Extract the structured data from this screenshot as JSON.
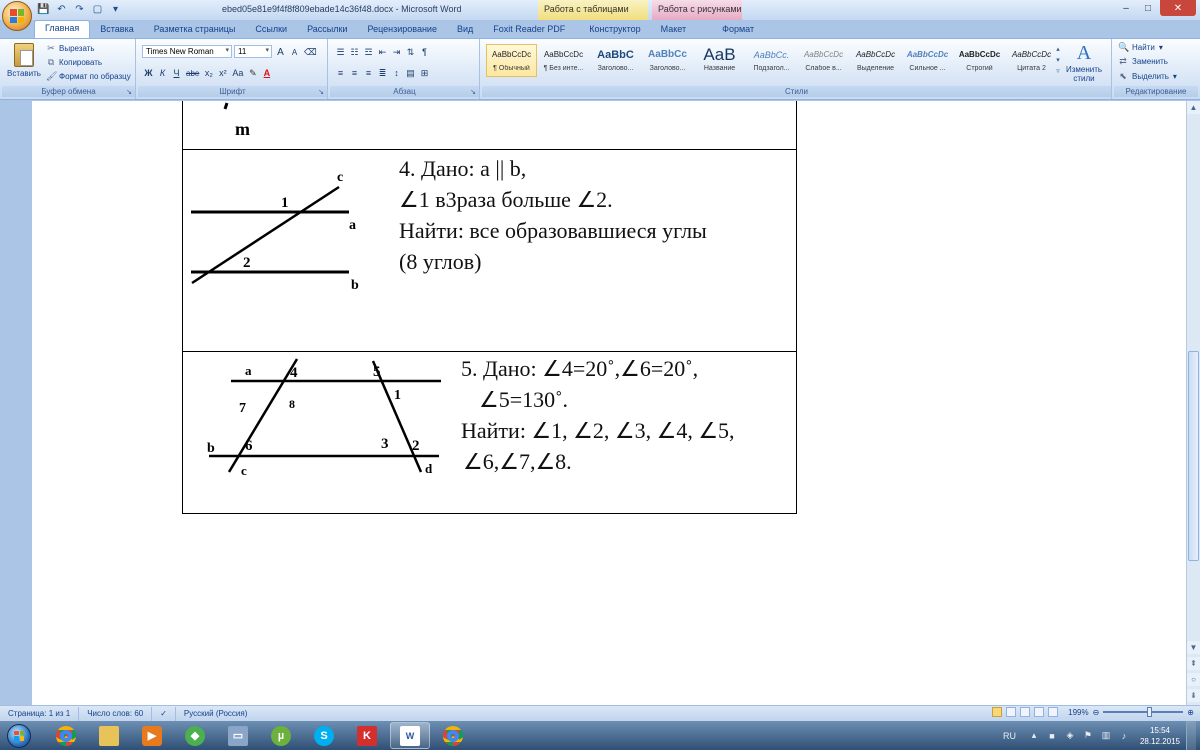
{
  "window": {
    "title": "ebed05e81e9f4f8f809ebade14c36f48.docx - Microsoft Word",
    "context_tabs": [
      "Работа с таблицами",
      "Работа с рисунками"
    ],
    "controls": [
      "–",
      "□",
      "✕"
    ]
  },
  "qat": [
    "💾",
    "↶",
    "↷",
    "▢",
    "▾"
  ],
  "tabs": [
    "Главная",
    "Вставка",
    "Разметка страницы",
    "Ссылки",
    "Рассылки",
    "Рецензирование",
    "Вид",
    "Foxit Reader PDF",
    "Конструктор",
    "Макет",
    "Формат"
  ],
  "ribbon": {
    "clipboard": {
      "group_label": "Буфер обмена",
      "paste": "Вставить",
      "cut": "Вырезать",
      "copy": "Копировать",
      "format_painter": "Формат по образцу"
    },
    "font": {
      "group_label": "Шрифт",
      "font_name": "Times New Roman",
      "font_size": "11",
      "grow": "A",
      "shrink": "A",
      "bold": "Ж",
      "italic": "К",
      "underline": "Ч",
      "strike": "abe",
      "subscript": "x₂",
      "superscript": "x²",
      "change_case": "Aa"
    },
    "paragraph": {
      "group_label": "Абзац",
      "pilcrow": "¶"
    },
    "styles": {
      "group_label": "Стили",
      "items": [
        {
          "sample": "AaBbCcDc",
          "name": "¶ Обычный"
        },
        {
          "sample": "AaBbCcDc",
          "name": "¶ Без инте..."
        },
        {
          "sample": "AaBbC",
          "name": "Заголово..."
        },
        {
          "sample": "AaBbCc",
          "name": "Заголово..."
        },
        {
          "sample": "AaB",
          "name": "Название"
        },
        {
          "sample": "AaBbCc.",
          "name": "Подзагол..."
        },
        {
          "sample": "AaBbCcDc",
          "name": "Слабое в..."
        },
        {
          "sample": "AaBbCcDc",
          "name": "Выделение"
        },
        {
          "sample": "AaBbCcDc",
          "name": "Сильное ..."
        },
        {
          "sample": "AaBbCcDc",
          "name": "Строгий"
        },
        {
          "sample": "AaBbCcDc",
          "name": "Цитата 2"
        }
      ],
      "change_styles": "Изменить стили"
    },
    "editing": {
      "group_label": "Редактирование",
      "find": "Найти",
      "replace": "Заменить",
      "select": "Выделить"
    }
  },
  "document": {
    "row0_fig_label": "m",
    "task4": {
      "line1": "4.  Дано: a || b,",
      "line2": "∠1 в3раза больше  ∠2.",
      "line3": "Найти: все образовавшиеся углы",
      "line4": "(8 углов)",
      "fig_labels": {
        "c": "c",
        "a": "a",
        "b": "b",
        "one": "1",
        "two": "2"
      }
    },
    "task5": {
      "line1": "5. Дано:  ∠4=20˚,∠6=20˚,",
      "line2": "∠5=130˚.",
      "line3": "Найти: ∠1, ∠2, ∠3, ∠4, ∠5,",
      "line4": "∠6,∠7,∠8.",
      "fig_labels": {
        "a": "a",
        "b": "b",
        "c": "c",
        "d": "d",
        "n1": "1",
        "n2": "2",
        "n3": "3",
        "n4": "4",
        "n5": "5",
        "n6": "6",
        "n7": "7",
        "n8": "8"
      }
    }
  },
  "statusbar": {
    "page": "Страница: 1 из 1",
    "words": "Число слов: 60",
    "language": "Русский (Россия)",
    "zoom": "199%"
  },
  "taskbar": {
    "lang": "RU",
    "time": "15:54",
    "date": "28.12.2015"
  }
}
